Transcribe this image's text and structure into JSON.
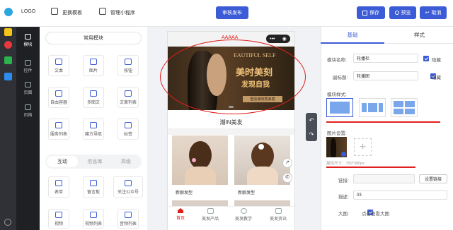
{
  "topbar": {
    "logo": "LOGO",
    "change_template": "更换模板",
    "manage_app": "管理小程序",
    "publish": "审核发布",
    "save": "保存",
    "preview": "预览",
    "cancel": "取消"
  },
  "sidenav": {
    "items": [
      {
        "label": "模块",
        "icon": "plus-square-icon"
      },
      {
        "label": "控件",
        "icon": "grid-icon"
      },
      {
        "label": "页面",
        "icon": "pages-icon"
      },
      {
        "label": "风格",
        "icon": "brush-icon"
      }
    ]
  },
  "module_panel": {
    "section_title": "常用模块",
    "common": [
      {
        "label": "文本",
        "icon": "text-icon"
      },
      {
        "label": "图片",
        "icon": "image-icon"
      },
      {
        "label": "按钮",
        "icon": "button-icon"
      },
      {
        "label": "自由容器",
        "icon": "container-icon"
      },
      {
        "label": "多图文",
        "icon": "multi-image-text-icon"
      },
      {
        "label": "文章列表",
        "icon": "article-list-icon"
      },
      {
        "label": "服务列表",
        "icon": "service-list-icon"
      },
      {
        "label": "魔方导航",
        "icon": "cube-nav-icon"
      },
      {
        "label": "标签",
        "icon": "tag-icon"
      }
    ],
    "tabs": [
      "互动",
      "信息库",
      "高级"
    ],
    "interactive": [
      {
        "label": "表单",
        "icon": "form-icon"
      },
      {
        "label": "留言板",
        "icon": "message-board-icon"
      },
      {
        "label": "关注公众号",
        "icon": "follow-account-icon"
      },
      {
        "label": "视频",
        "icon": "video-icon"
      },
      {
        "label": "视频列表",
        "icon": "video-list-icon"
      },
      {
        "label": "音频列表",
        "icon": "audio-list-icon"
      }
    ]
  },
  "phone": {
    "title": "AAAAA",
    "banner_en": "EAUTIFUL SELF",
    "banner_cn1": "美时美刻",
    "banner_cn2": "发现自我",
    "banner_button": "塑造潮流秀美丽",
    "section_title": "潮IN美发",
    "products": [
      {
        "label": "新娘发型"
      },
      {
        "label": "新娘发型"
      }
    ],
    "bottom_nav": [
      {
        "label": "首页",
        "icon": "home-icon"
      },
      {
        "label": "美发产品",
        "icon": "product-grid-icon"
      },
      {
        "label": "美发教学",
        "icon": "clock-icon"
      },
      {
        "label": "美发资讯",
        "icon": "news-icon"
      }
    ]
  },
  "properties": {
    "tabs": [
      "基础",
      "样式"
    ],
    "module_name_label": "模块名称:",
    "module_name_value": "轮播栏",
    "hide_label": "隐藏",
    "subtitle_label": "副标题:",
    "subtitle_value": "轮播图",
    "style_label": "模块样式:",
    "image_setting_label": "图片设置:",
    "suggest_size": "最佳尺寸：750*360px",
    "link_label": "链接:",
    "link_button": "设置链接",
    "interval_label": "描述:",
    "interval_value": "03",
    "zoom_label": "大图:",
    "zoom_option": "点击查看大图"
  },
  "colors": {
    "accent": "#3c5bd6",
    "annotation": "#e0201c"
  }
}
